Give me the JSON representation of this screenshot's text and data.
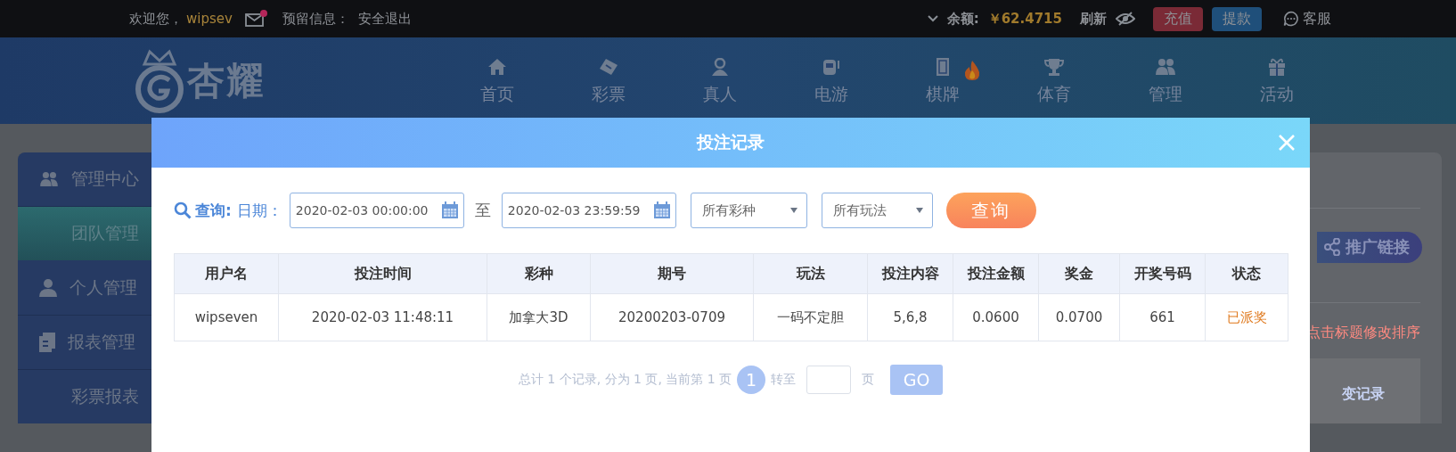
{
  "top_bar": {
    "welcome": "欢迎您，",
    "username": "wipsev",
    "has_mail": true,
    "notice_label": "预留信息：",
    "logout": "安全退出",
    "balance_label": "余额:",
    "balance": "￥62.4715",
    "refresh": "刷新",
    "deposit": "充值",
    "withdraw": "提款",
    "support": "客服"
  },
  "logo": {
    "text": "杏耀"
  },
  "nav": [
    {
      "label": "首页",
      "kind": "home",
      "hot": false
    },
    {
      "label": "彩票",
      "kind": "ticket",
      "hot": false
    },
    {
      "label": "真人",
      "kind": "person",
      "hot": false
    },
    {
      "label": "电游",
      "kind": "slot",
      "hot": false
    },
    {
      "label": "棋牌",
      "kind": "card",
      "hot": true
    },
    {
      "label": "体育",
      "kind": "trophy",
      "hot": false
    },
    {
      "label": "管理",
      "kind": "people",
      "hot": false
    },
    {
      "label": "活动",
      "kind": "gift",
      "hot": false
    }
  ],
  "sidebar": [
    {
      "label": "管理中心",
      "kind": "people",
      "children": [
        {
          "label": "团队管理",
          "selected": true
        }
      ]
    },
    {
      "label": "个人管理",
      "kind": "person"
    },
    {
      "label": "报表管理",
      "kind": "doc",
      "children": [
        {
          "label": "彩票报表",
          "selected": false
        }
      ]
    }
  ],
  "main_panel": {
    "promote_button": "推广链接",
    "sort_hint": "点击标题修改排序",
    "link": "变记录"
  },
  "modal": {
    "title": "投注记录",
    "filters": {
      "query_label": "查询:",
      "date_label": "日期：",
      "start": {
        "value": "2020-02-03 00:00:00"
      },
      "to": "至",
      "end": {
        "value": "2020-02-03 23:59:59"
      },
      "lottery_select": "所有彩种",
      "play_select": "所有玩法",
      "query_button": "查询"
    },
    "table": {
      "columns": [
        "用户名",
        "投注时间",
        "彩种",
        "期号",
        "玩法",
        "投注内容",
        "投注金额",
        "奖金",
        "开奖号码",
        "状态"
      ],
      "rows": [
        {
          "cells": [
            "wipseven",
            "2020-02-03 11:48:11",
            "加拿大3D",
            "20200203-0709",
            "一码不定胆",
            "5,6,8",
            "0.0600",
            "0.0700",
            "661",
            "已派奖"
          ]
        }
      ]
    },
    "pagination": {
      "summary": "总计 1 个记录, 分为 1 页, 当前第 1 页",
      "pages": [
        {
          "label": "1",
          "selected": true
        }
      ],
      "goto_label": "转至",
      "page_unit": "页",
      "go": "GO"
    }
  }
}
